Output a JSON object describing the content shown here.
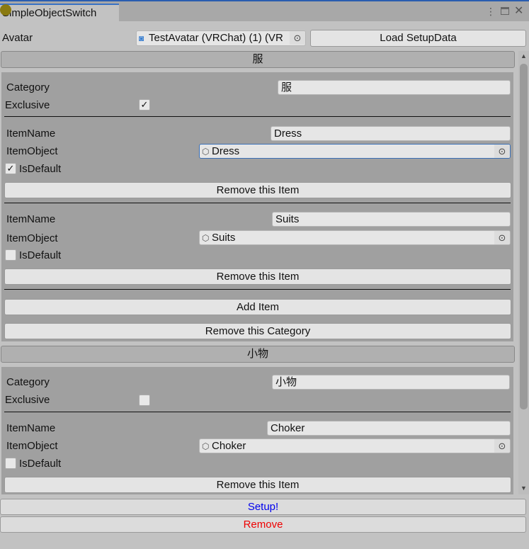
{
  "window": {
    "tab_title": "SimpleObjectSwitch",
    "menu_icon": "kebab-icon",
    "maximize_icon": "maximize-icon",
    "close_icon": "close-icon"
  },
  "avatar": {
    "label": "Avatar",
    "value": "TestAvatar (VRChat) (1) (VR",
    "load_button": "Load SetupData"
  },
  "categories": [
    {
      "header": "服",
      "category_label": "Category",
      "category_value": "服",
      "exclusive_label": "Exclusive",
      "exclusive": true,
      "items": [
        {
          "name_label": "ItemName",
          "name": "Dress",
          "object_label": "ItemObject",
          "object": "Dress",
          "default_label": "IsDefault",
          "is_default": true,
          "remove": "Remove this Item"
        },
        {
          "name_label": "ItemName",
          "name": "Suits",
          "object_label": "ItemObject",
          "object": "Suits",
          "default_label": "IsDefault",
          "is_default": false,
          "remove": "Remove this Item"
        }
      ],
      "add_item": "Add Item",
      "remove_category": "Remove this Category"
    },
    {
      "header": "小物",
      "category_label": "Category",
      "category_value": "小物",
      "exclusive_label": "Exclusive",
      "exclusive": false,
      "items": [
        {
          "name_label": "ItemName",
          "name": "Choker",
          "object_label": "ItemObject",
          "object": "Choker",
          "default_label": "IsDefault",
          "is_default": false,
          "remove": "Remove this Item"
        }
      ]
    }
  ],
  "footer": {
    "setup": "Setup!",
    "remove": "Remove",
    "setup_color": "#0000ee",
    "remove_color": "#ee0000"
  },
  "check_mark": "✓"
}
